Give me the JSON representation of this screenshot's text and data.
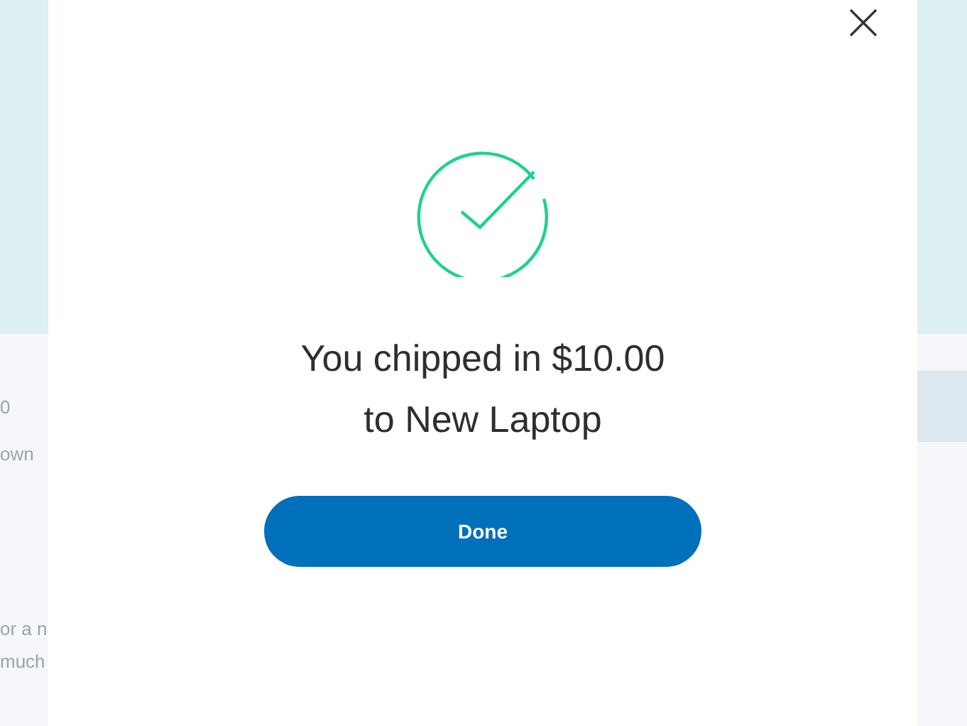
{
  "background": {
    "texts": [
      "0",
      "own",
      "or a n",
      "much"
    ]
  },
  "modal": {
    "message_lines": [
      "You chipped in $10.00",
      "to New Laptop"
    ],
    "button": "Done"
  }
}
